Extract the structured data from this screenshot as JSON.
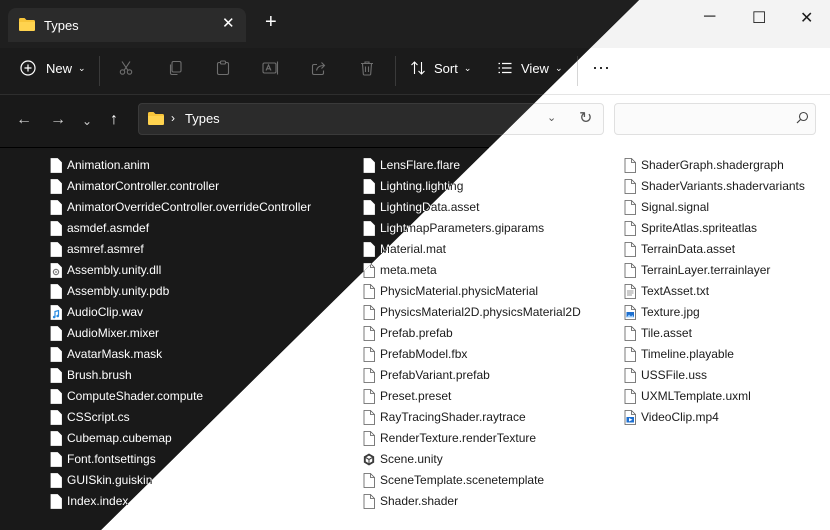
{
  "window": {
    "tab_title": "Types",
    "new_tab_symbol": "+",
    "close_tab_symbol": "✕",
    "controls": {
      "minimize": "─",
      "maximize": "☐",
      "close": "✕"
    }
  },
  "toolbar": {
    "new_label": "New",
    "sort_label": "Sort",
    "view_label": "View",
    "more_label": "⋯",
    "icons": [
      "cut-icon",
      "copy-icon",
      "paste-icon",
      "rename-icon",
      "share-icon",
      "delete-icon"
    ]
  },
  "address": {
    "breadcrumb": "Types",
    "search_placeholder": ""
  },
  "files": {
    "col1": [
      {
        "name": "Animation.anim",
        "icon": "file-icon"
      },
      {
        "name": "AnimatorController.controller",
        "icon": "file-icon"
      },
      {
        "name": "AnimatorOverrideController.overrideController",
        "icon": "file-icon"
      },
      {
        "name": "asmdef.asmdef",
        "icon": "file-icon"
      },
      {
        "name": "asmref.asmref",
        "icon": "file-icon"
      },
      {
        "name": "Assembly.unity.dll",
        "icon": "dll-icon"
      },
      {
        "name": "Assembly.unity.pdb",
        "icon": "file-icon"
      },
      {
        "name": "AudioClip.wav",
        "icon": "audio-file-icon"
      },
      {
        "name": "AudioMixer.mixer",
        "icon": "file-icon"
      },
      {
        "name": "AvatarMask.mask",
        "icon": "file-icon"
      },
      {
        "name": "Brush.brush",
        "icon": "file-icon"
      },
      {
        "name": "ComputeShader.compute",
        "icon": "file-icon"
      },
      {
        "name": "CSScript.cs",
        "icon": "file-icon"
      },
      {
        "name": "Cubemap.cubemap",
        "icon": "file-icon"
      },
      {
        "name": "Font.fontsettings",
        "icon": "file-icon"
      },
      {
        "name": "GUISkin.guiskin",
        "icon": "file-icon"
      },
      {
        "name": "Index.index",
        "icon": "file-icon"
      }
    ],
    "col2": [
      {
        "name": "LensFlare.flare",
        "icon": "file-icon"
      },
      {
        "name": "Lighting.lighting",
        "icon": "file-icon"
      },
      {
        "name": "LightingData.asset",
        "icon": "file-icon"
      },
      {
        "name": "LightmapParameters.giparams",
        "icon": "file-icon"
      },
      {
        "name": "Material.mat",
        "icon": "file-icon"
      },
      {
        "name": "meta.meta",
        "icon": "file-icon"
      },
      {
        "name": "PhysicMaterial.physicMaterial",
        "icon": "file-icon"
      },
      {
        "name": "PhysicsMaterial2D.physicsMaterial2D",
        "icon": "file-icon"
      },
      {
        "name": "Prefab.prefab",
        "icon": "file-icon"
      },
      {
        "name": "PrefabModel.fbx",
        "icon": "file-icon"
      },
      {
        "name": "PrefabVariant.prefab",
        "icon": "file-icon"
      },
      {
        "name": "Preset.preset",
        "icon": "file-icon"
      },
      {
        "name": "RayTracingShader.raytrace",
        "icon": "file-icon"
      },
      {
        "name": "RenderTexture.renderTexture",
        "icon": "file-icon"
      },
      {
        "name": "Scene.unity",
        "icon": "unity-icon"
      },
      {
        "name": "SceneTemplate.scenetemplate",
        "icon": "file-icon"
      },
      {
        "name": "Shader.shader",
        "icon": "file-icon"
      }
    ],
    "col3": [
      {
        "name": "ShaderGraph.shadergraph",
        "icon": "file-icon"
      },
      {
        "name": "ShaderVariants.shadervariants",
        "icon": "file-icon"
      },
      {
        "name": "Signal.signal",
        "icon": "file-icon"
      },
      {
        "name": "SpriteAtlas.spriteatlas",
        "icon": "file-icon"
      },
      {
        "name": "TerrainData.asset",
        "icon": "file-icon"
      },
      {
        "name": "TerrainLayer.terrainlayer",
        "icon": "file-icon"
      },
      {
        "name": "TextAsset.txt",
        "icon": "text-file-icon"
      },
      {
        "name": "Texture.jpg",
        "icon": "image-file-icon"
      },
      {
        "name": "Tile.asset",
        "icon": "file-icon"
      },
      {
        "name": "Timeline.playable",
        "icon": "file-icon"
      },
      {
        "name": "USSFile.uss",
        "icon": "file-icon"
      },
      {
        "name": "UXMLTemplate.uxml",
        "icon": "file-icon"
      },
      {
        "name": "VideoClip.mp4",
        "icon": "video-file-icon"
      }
    ]
  },
  "colors": {
    "folder": "#f8c53a",
    "audio_accent": "#2a8be0",
    "image_accent": "#1e6fcf"
  }
}
